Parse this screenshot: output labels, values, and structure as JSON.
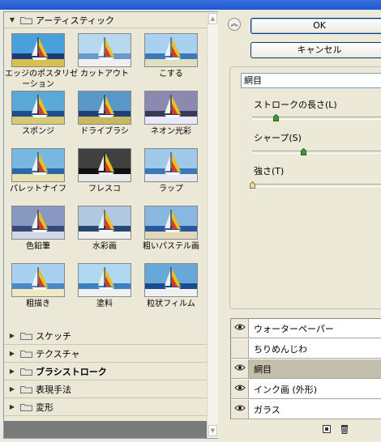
{
  "gallery": {
    "open_category": "アーティスティック",
    "filters": [
      {
        "label": "エッジのポスタリゼーション",
        "label_line1": "エッジのポスタリゼ",
        "label_line2": "ーション",
        "style": "posterize"
      },
      {
        "label": "カットアウト",
        "style": "cutout"
      },
      {
        "label": "こする",
        "style": "smudge"
      },
      {
        "label": "スポンジ",
        "style": "sponge"
      },
      {
        "label": "ドライブラシ",
        "style": "drybrush"
      },
      {
        "label": "ネオン光彩",
        "style": "neon"
      },
      {
        "label": "パレットナイフ",
        "style": "palette"
      },
      {
        "label": "フレスコ",
        "style": "fresco"
      },
      {
        "label": "ラップ",
        "style": "wrap"
      },
      {
        "label": "色鉛筆",
        "style": "pencil"
      },
      {
        "label": "水彩画",
        "style": "watercolor"
      },
      {
        "label": "粗いパステル画",
        "style": "pastel"
      },
      {
        "label": "粗描き",
        "style": "rough"
      },
      {
        "label": "塗料",
        "style": "paint"
      },
      {
        "label": "粒状フィルム",
        "style": "grain"
      }
    ],
    "collapsed_categories": [
      {
        "label": "スケッチ",
        "bold": false
      },
      {
        "label": "テクスチャ",
        "bold": false
      },
      {
        "label": "ブラシストローク",
        "bold": true
      },
      {
        "label": "表現手法",
        "bold": false
      },
      {
        "label": "変形",
        "bold": false
      }
    ]
  },
  "buttons": {
    "ok": "OK",
    "cancel": "キャンセル"
  },
  "settings": {
    "filter_select": "網目",
    "sliders": [
      {
        "label": "ストロークの長さ(L)",
        "fraction": 0.17
      },
      {
        "label": "シャープ(S)",
        "fraction": 0.37
      },
      {
        "label": "強さ(T)",
        "fraction": 0.0
      }
    ]
  },
  "layers": [
    {
      "name": "ウォーターペーパー",
      "visible": true,
      "selected": false
    },
    {
      "name": "ちりめんじわ",
      "visible": false,
      "selected": false
    },
    {
      "name": "網目",
      "visible": true,
      "selected": true
    },
    {
      "name": "インク画 (外形)",
      "visible": true,
      "selected": false
    },
    {
      "name": "ガラス",
      "visible": true,
      "selected": false
    }
  ],
  "icons": {
    "collapse": "double-chevron-up-icon",
    "new_layer": "new-layer-icon",
    "delete_layer": "trash-icon",
    "eye": "eye-icon",
    "folder": "folder-icon"
  },
  "colors": {
    "accent_blue": "#1d58d6",
    "panel": "#ece9d8",
    "selected_row": "#c2bfad"
  }
}
